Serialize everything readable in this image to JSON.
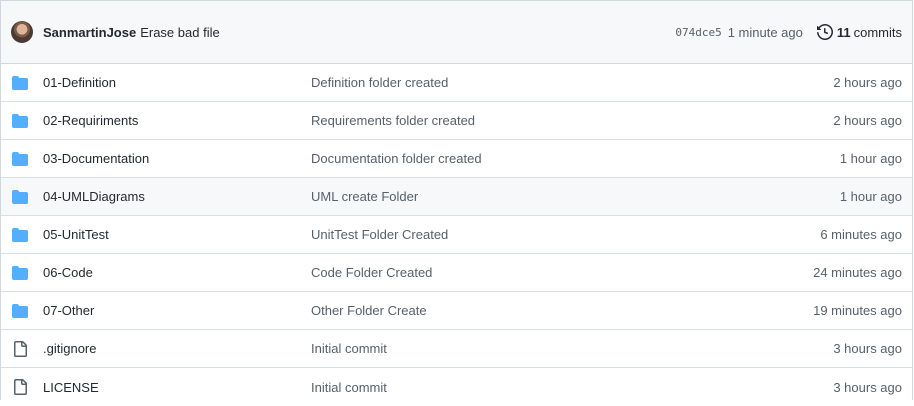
{
  "latest_commit": {
    "author": "SanmartinJose",
    "message": "Erase bad file",
    "sha": "074dce5",
    "time_ago": "1 minute ago",
    "commits_count": "11",
    "commits_label": "commits"
  },
  "files": [
    {
      "type": "folder",
      "icon": "folder-icon",
      "name": "01-Definition",
      "message": "Definition folder created",
      "age": "2 hours ago"
    },
    {
      "type": "folder",
      "icon": "folder-icon",
      "name": "02-Requiriments",
      "message": "Requirements folder created",
      "age": "2 hours ago"
    },
    {
      "type": "folder",
      "icon": "folder-icon",
      "name": "03-Documentation",
      "message": "Documentation folder created",
      "age": "1 hour ago"
    },
    {
      "type": "folder",
      "icon": "folder-icon",
      "name": "04-UMLDiagrams",
      "message": "UML create Folder",
      "age": "1 hour ago"
    },
    {
      "type": "folder",
      "icon": "folder-icon",
      "name": "05-UnitTest",
      "message": "UnitTest Folder Created",
      "age": "6 minutes ago"
    },
    {
      "type": "folder",
      "icon": "folder-icon",
      "name": "06-Code",
      "message": "Code Folder Created",
      "age": "24 minutes ago"
    },
    {
      "type": "folder",
      "icon": "folder-icon",
      "name": "07-Other",
      "message": "Other Folder Create",
      "age": "19 minutes ago"
    },
    {
      "type": "file",
      "icon": "file-icon",
      "name": ".gitignore",
      "message": "Initial commit",
      "age": "3 hours ago"
    },
    {
      "type": "file",
      "icon": "file-icon",
      "name": "LICENSE",
      "message": "Initial commit",
      "age": "3 hours ago"
    }
  ],
  "colors": {
    "folder": "#54aeff",
    "file_icon": "#57606a",
    "border": "#d0d7de",
    "header_bg": "#f6f8fa"
  }
}
